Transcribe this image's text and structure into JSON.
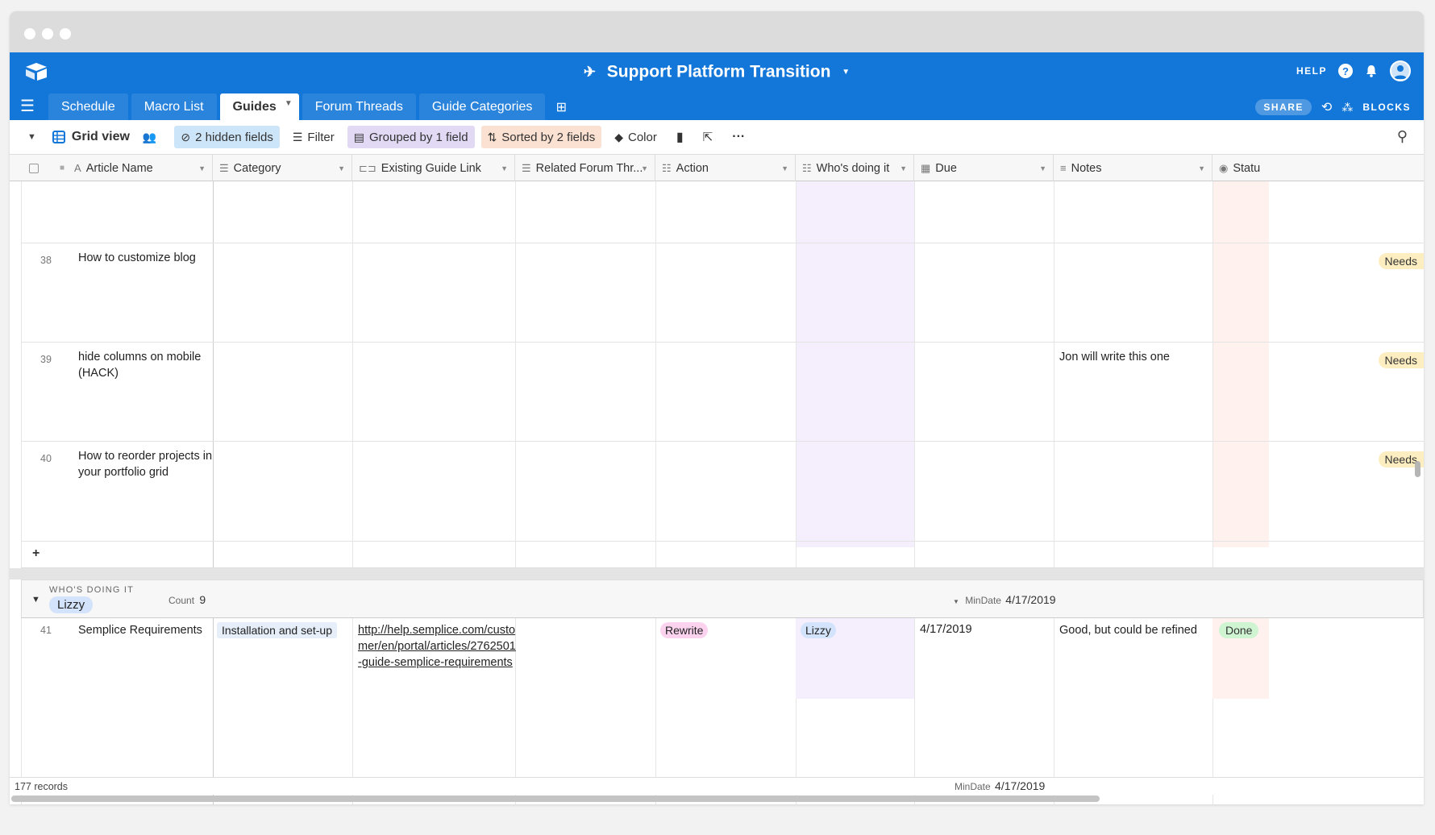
{
  "app": {
    "title": "Support Platform Transition",
    "help_label": "HELP",
    "share_label": "SHARE",
    "blocks_label": "BLOCKS",
    "accent": "#1377d9"
  },
  "tabs": [
    {
      "label": "Schedule"
    },
    {
      "label": "Macro List"
    },
    {
      "label": "Guides"
    },
    {
      "label": "Forum Threads"
    },
    {
      "label": "Guide Categories"
    }
  ],
  "toolbar": {
    "view_name": "Grid view",
    "hidden_fields": "2 hidden fields",
    "filter": "Filter",
    "grouped": "Grouped by 1 field",
    "sorted": "Sorted by 2 fields",
    "color": "Color"
  },
  "columns": [
    {
      "label": "Article Name",
      "icon": "text-field-icon"
    },
    {
      "label": "Category",
      "icon": "single-select-icon"
    },
    {
      "label": "Existing Guide Link",
      "icon": "link-field-icon"
    },
    {
      "label": "Related Forum Thr...",
      "icon": "linked-record-icon"
    },
    {
      "label": "Action",
      "icon": "multi-select-icon"
    },
    {
      "label": "Who's doing it",
      "icon": "multi-select-icon"
    },
    {
      "label": "Due",
      "icon": "calendar-icon"
    },
    {
      "label": "Notes",
      "icon": "long-text-icon"
    },
    {
      "label": "Statu",
      "icon": "status-icon"
    }
  ],
  "rows": [
    {
      "num": "38",
      "name": "How to customize blog",
      "notes": "",
      "status": "Needs"
    },
    {
      "num": "39",
      "name_line1": "hide columns on mobile",
      "name_line2": "(HACK)",
      "notes": "Jon will write this one",
      "status": "Needs"
    },
    {
      "num": "40",
      "name_line1": "How to reorder projects in",
      "name_line2": "your portfolio grid",
      "notes": "",
      "status": "Needs"
    }
  ],
  "add_row_label": "+",
  "group": {
    "field_label": "WHO'S DOING IT",
    "value": "Lizzy",
    "count_label": "Count",
    "count": "9",
    "mindate_label": "MinDate",
    "mindate": "4/17/2019"
  },
  "group_row": {
    "num": "41",
    "name": "Semplice Requirements",
    "category": "Installation and set-up",
    "link_line1": "http://help.semplice.com/custo",
    "link_line2": "mer/en/portal/articles/2762501",
    "link_line3": "-guide-semplice-requirements",
    "action": "Rewrite",
    "who": "Lizzy",
    "due": "4/17/2019",
    "notes": "Good, but could be refined",
    "status": "Done"
  },
  "footer": {
    "records": "177 records",
    "mindate_label": "MinDate",
    "mindate": "4/17/2019"
  }
}
